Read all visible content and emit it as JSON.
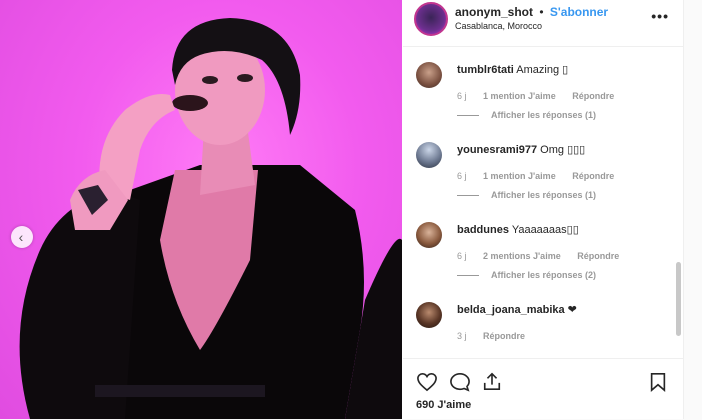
{
  "post": {
    "username": "anonym_shot",
    "separator": "•",
    "follow_label": "S'abonner",
    "location": "Casablanca, Morocco",
    "more_label": "•••",
    "likes_text": "690 J'aime"
  },
  "comments": [
    {
      "username": "tumblr6tati",
      "text": "Amazing ▯",
      "age": "6 j",
      "likes": "1 mention J'aime",
      "reply": "Répondre",
      "replies": "Afficher les réponses (1)"
    },
    {
      "username": "younesrami977",
      "text": "Omg ▯▯▯",
      "age": "6 j",
      "likes": "1 mention J'aime",
      "reply": "Répondre",
      "replies": "Afficher les réponses (1)"
    },
    {
      "username": "baddunes",
      "text": "Yaaaaaaas▯▯",
      "age": "6 j",
      "likes": "2 mentions J'aime",
      "reply": "Répondre",
      "replies": "Afficher les réponses (2)"
    },
    {
      "username": "belda_joana_mabika",
      "text": "❤",
      "age": "3 j",
      "reply": "Répondre"
    }
  ],
  "colors": {
    "accent": "#3897f0",
    "photo_bg": "#f25bee",
    "text": "#262626",
    "muted": "#999999"
  },
  "icons": [
    "chevron-left-icon",
    "heart-icon",
    "comment-icon",
    "share-icon",
    "bookmark-icon",
    "more-icon"
  ]
}
